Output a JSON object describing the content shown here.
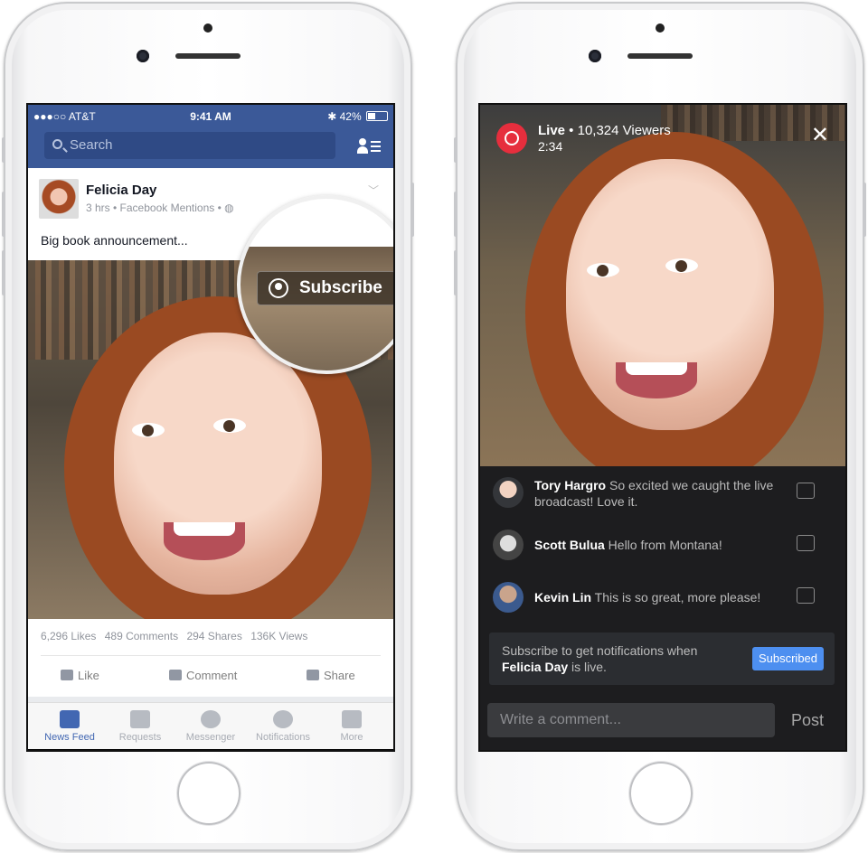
{
  "left_phone": {
    "status": {
      "carrier": "●●●○○ AT&T",
      "time": "9:41 AM",
      "battery": "42%"
    },
    "search_placeholder": "Search",
    "post": {
      "author": "Felicia Day",
      "meta": "3 hrs • Facebook Mentions • ",
      "text": "Big book announcement...",
      "subscribe_label": "Subscribe"
    },
    "stats": {
      "likes": "6,296 Likes",
      "comments": "489 Comments",
      "shares": "294 Shares",
      "views": "136K Views"
    },
    "actions": {
      "like": "Like",
      "comment": "Comment",
      "share": "Share"
    },
    "tabs": [
      "News Feed",
      "Requests",
      "Messenger",
      "Notifications",
      "More"
    ]
  },
  "right_phone": {
    "live_label": "Live",
    "viewers": " • 10,324 Viewers",
    "duration": "2:34",
    "close": "✕",
    "comments": [
      {
        "name": "Tory Hargro",
        "text": " So excited we caught the live broadcast! Love it."
      },
      {
        "name": "Scott Bulua",
        "text": " Hello from Montana!"
      },
      {
        "name": "Kevin Lin",
        "text": " This is so great, more please!"
      }
    ],
    "notify": {
      "prefix": "Subscribe to get notifications when ",
      "name": "Felicia Day",
      "suffix": " is live."
    },
    "subscribed_label": "Subscribed",
    "comment_placeholder": "Write a comment...",
    "post_label": "Post"
  },
  "colors": {
    "facebook_blue": "#3b5998",
    "live_red": "#e62e3d",
    "subscribed_blue": "#4d8ff0"
  }
}
